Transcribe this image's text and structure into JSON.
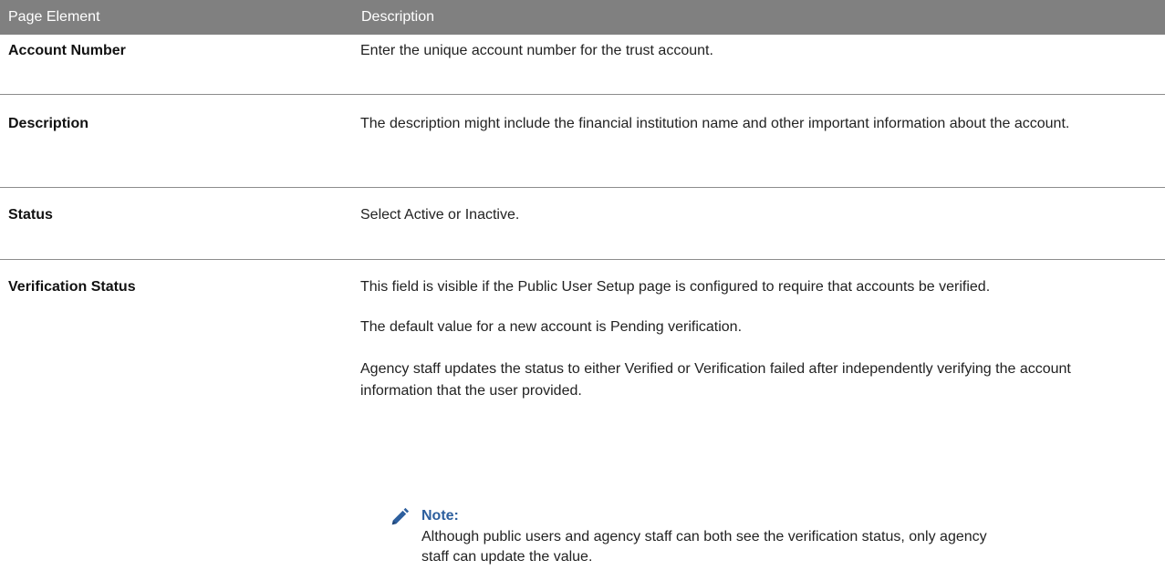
{
  "table": {
    "headers": [
      "Page Element",
      "Description"
    ],
    "rows": [
      {
        "element": "Account Number",
        "paragraphs": [
          "Enter the unique account number for the trust account."
        ]
      },
      {
        "element": "Description",
        "paragraphs": [
          "The description might include the financial institution name and other important information about the account."
        ]
      },
      {
        "element": "Status",
        "paragraphs": [
          "Select Active or Inactive."
        ]
      },
      {
        "element": "Verification Status",
        "paragraphs": [
          "This field is visible if the Public User Setup page is configured to require that accounts be verified.",
          "The default value for a new account is Pending verification.",
          "Agency staff updates the status to either Verified or Verification failed after independently verifying the account information that the user provided."
        ],
        "note": {
          "icon": "pencil-icon",
          "title": "Note:",
          "text": "Although public users and agency staff can both see the verification status, only agency staff can update the value."
        }
      }
    ]
  },
  "colors": {
    "header_bg": "#808080",
    "note_title": "#2d5f9e",
    "divider": "#8c8c8c"
  }
}
